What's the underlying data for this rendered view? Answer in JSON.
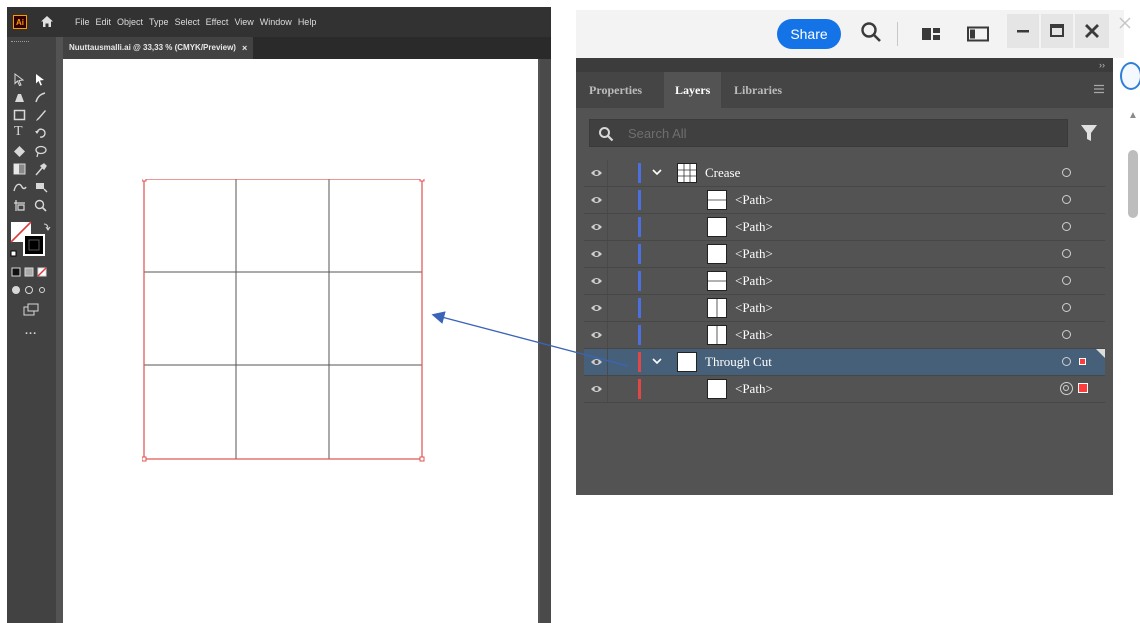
{
  "illustrator": {
    "logo": "Ai",
    "menu": [
      "File",
      "Edit",
      "Object",
      "Type",
      "Select",
      "Effect",
      "View",
      "Window",
      "Help"
    ],
    "document_tab": "Nuuttausmalli.ai @ 33,33 % (CMYK/Preview)",
    "close_glyph": "×",
    "toolbar_more": "..."
  },
  "topbar": {
    "share_label": "Share"
  },
  "panel": {
    "tabs": [
      "Properties",
      "Layers",
      "Libraries"
    ],
    "collapse_glyph": "››",
    "search_placeholder": "Search All",
    "layers": [
      {
        "name": "Crease",
        "type": "layer",
        "expanded": true,
        "color": "#4c6fe0",
        "thumb": "grid"
      },
      {
        "name": "<Path>",
        "type": "path",
        "color": "#4c6fe0",
        "thumb": "hline"
      },
      {
        "name": "<Path>",
        "type": "path",
        "color": "#4c6fe0",
        "thumb": "blank"
      },
      {
        "name": "<Path>",
        "type": "path",
        "color": "#4c6fe0",
        "thumb": "blank"
      },
      {
        "name": "<Path>",
        "type": "path",
        "color": "#4c6fe0",
        "thumb": "hline"
      },
      {
        "name": "<Path>",
        "type": "path",
        "color": "#4c6fe0",
        "thumb": "vline"
      },
      {
        "name": "<Path>",
        "type": "path",
        "color": "#4c6fe0",
        "thumb": "vline"
      },
      {
        "name": "Through Cut",
        "type": "layer",
        "expanded": true,
        "color": "#e04848",
        "thumb": "blank",
        "selected": true
      },
      {
        "name": "<Path>",
        "type": "path",
        "color": "#e04848",
        "thumb": "blank",
        "targeted": true
      }
    ]
  },
  "colors": {
    "crease_layer": "#4c6fe0",
    "through_cut_layer": "#e04848",
    "share_button": "#1473e6",
    "arrow": "#3a64b8"
  }
}
